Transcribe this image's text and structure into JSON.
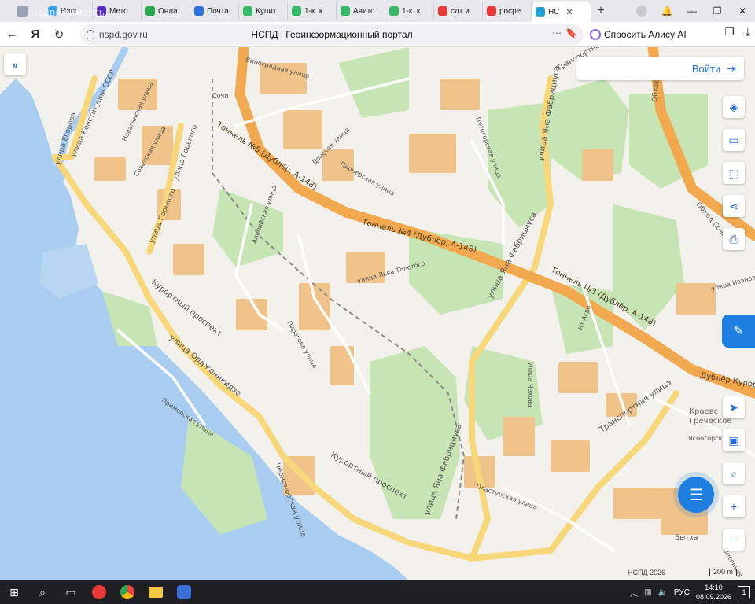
{
  "browser": {
    "watermark": "недвижимость",
    "tabs": [
      {
        "label": "Наш",
        "color": "#3aa0e8"
      },
      {
        "label": "Мето",
        "color": "#5b2ec8"
      },
      {
        "label": "Онла",
        "color": "#2aa84a"
      },
      {
        "label": "Почта",
        "color": "#2f6fe0"
      },
      {
        "label": "Купит",
        "color": "#39b86a"
      },
      {
        "label": "1-к. к",
        "color": "#39b86a"
      },
      {
        "label": "Авито",
        "color": "#39b86a"
      },
      {
        "label": "1-к. к",
        "color": "#39b86a"
      },
      {
        "label": "сдт и",
        "color": "#e83a3a"
      },
      {
        "label": "росре",
        "color": "#e83a3a"
      },
      {
        "label": "НС",
        "color": "#21a0d6",
        "active": true
      }
    ],
    "tab_close": "✕",
    "new_tab": "+",
    "url": "nspd.gov.ru",
    "page_title": "НСПД | Геоинформационный портал",
    "alice_label": "Спросить Алису AI"
  },
  "map": {
    "login_label": "Войти",
    "tunnels": [
      "Тоннель №5 (Дублёр, А-148)",
      "Тоннель №4 (Дублёр, А-148)",
      "Тоннель №3 (Дублёр, А-148)",
      "Дублёр Курорт"
    ],
    "streets": [
      "улица Егорова",
      "улица Конституции СССР",
      "улица Горького",
      "улица Горького",
      "Навагинская улица",
      "Советская улица",
      "Курортный проспект",
      "Курортный проспект",
      "улица Орджоникидзе",
      "Приморская улица",
      "Черноморская улица",
      "улица Яна Фабрициуса",
      "улица Яна Фабрициуса",
      "улица Яна Фабрициуса",
      "Транспортная улица",
      "Транспортная улица",
      "Альпийская улица",
      "Пирогова улица",
      "Пятигорская улица",
      "Ясногорская",
      "улица Иванова",
      "Обход Сочи",
      "Обход Сочи",
      "Пионерская улица",
      "Виноградная улица",
      "Донская улица",
      "улица Льва Толстого",
      "улица Чехова",
      "Пластунская улица",
      "Бытха",
      "Весенняя",
      "Сочи",
      "Кт Агро"
    ],
    "district": "Краевс\nГреческое",
    "copyright": "НСПД 2026",
    "scale_label": "200 m"
  },
  "taskbar": {
    "lang": "РУС",
    "time": "14:10",
    "date": "08.09.2026",
    "notify_count": "1"
  }
}
